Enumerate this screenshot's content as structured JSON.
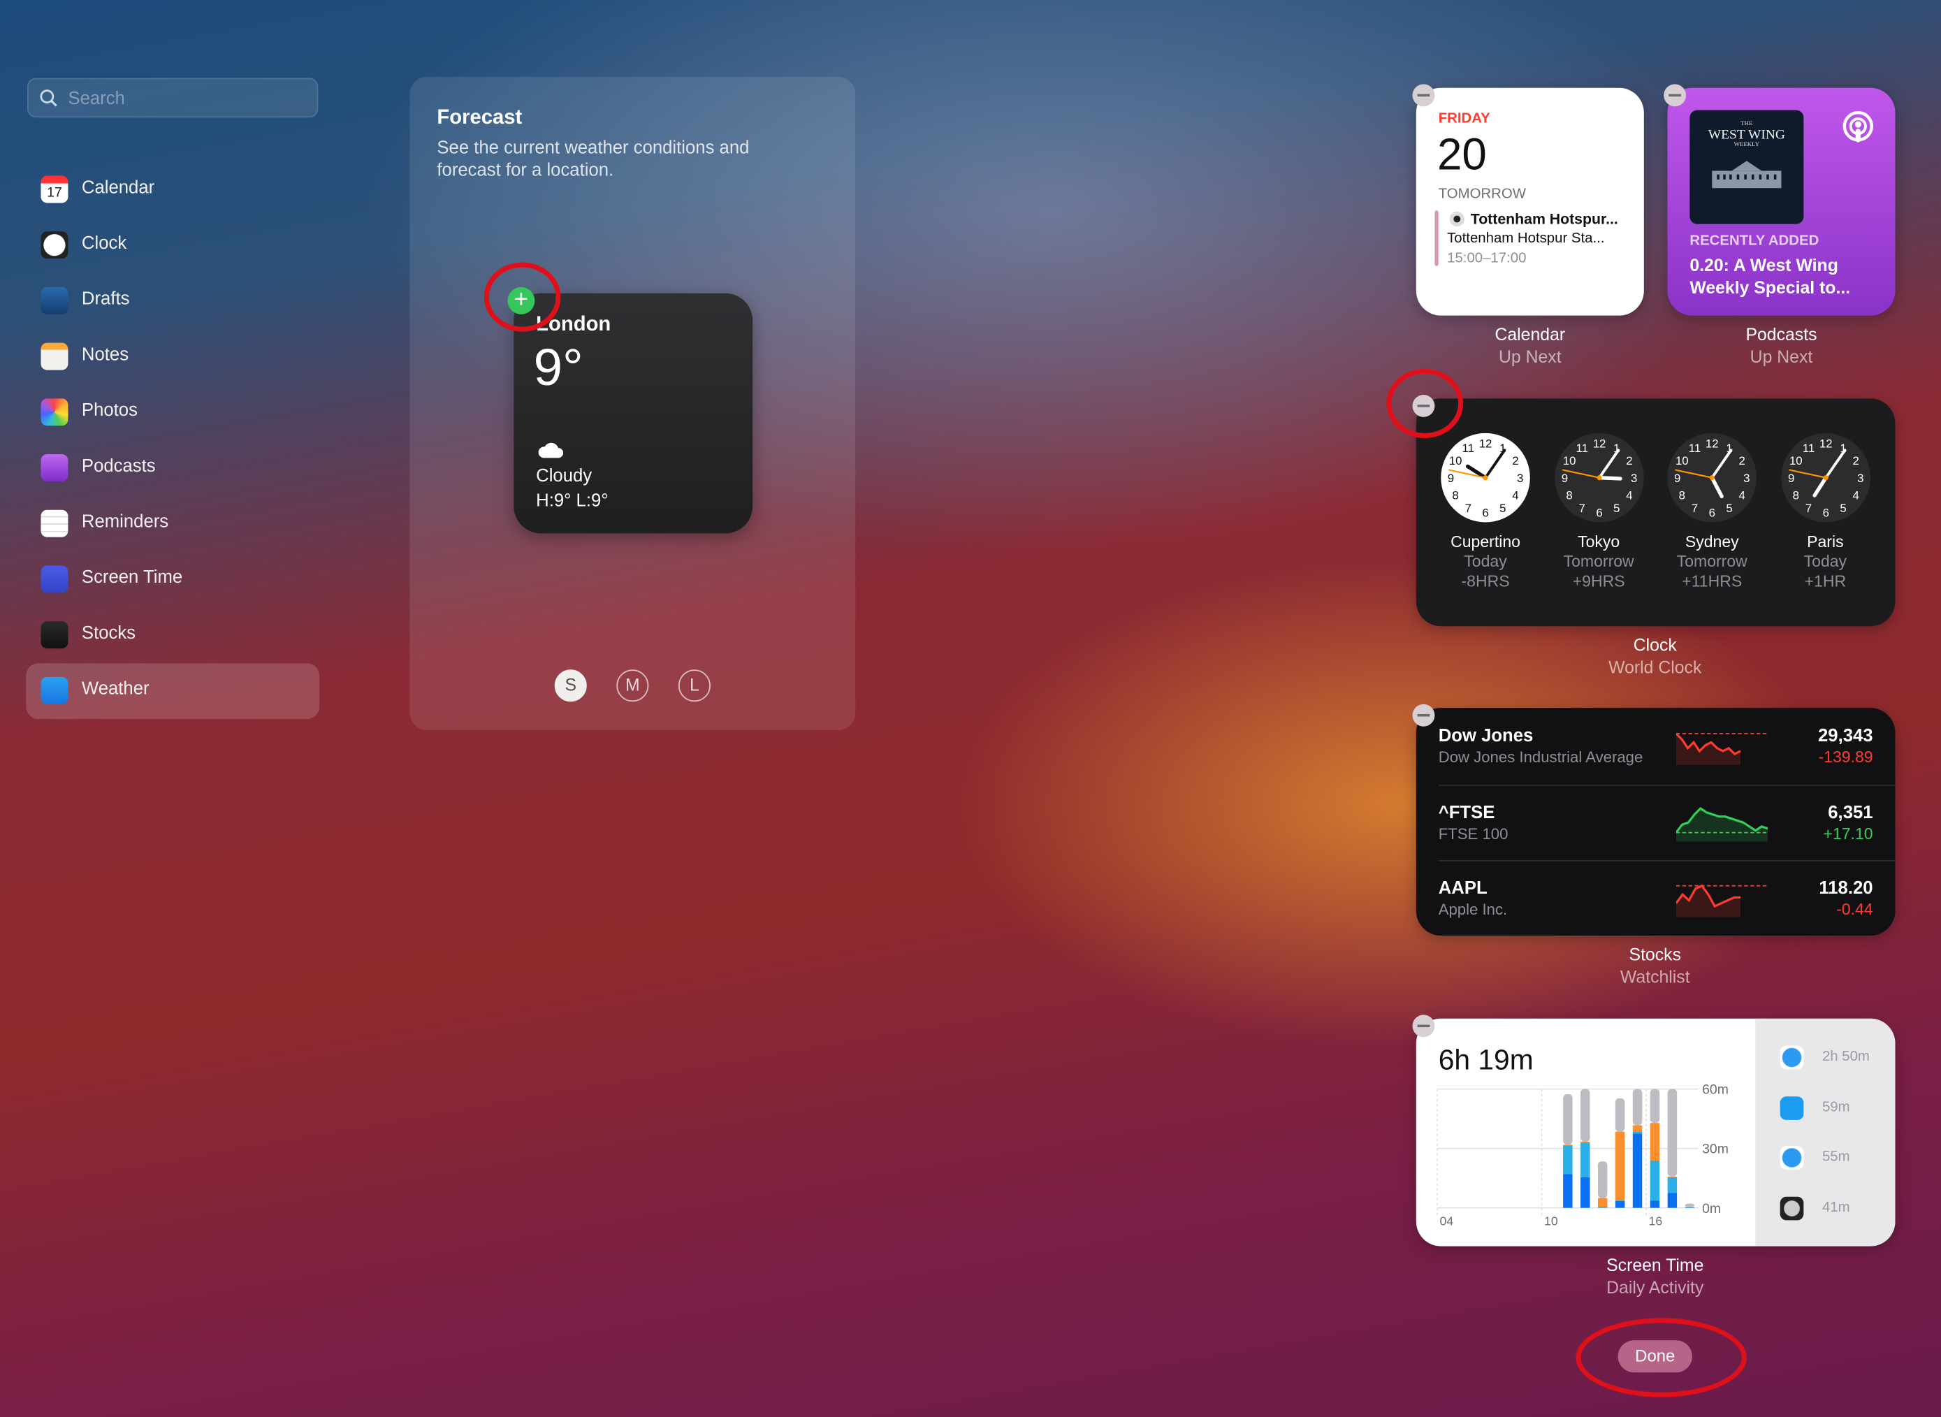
{
  "search": {
    "placeholder": "Search"
  },
  "sidebar": {
    "items": [
      {
        "label": "Calendar",
        "icon": "calendar-icon",
        "badge": "17"
      },
      {
        "label": "Clock",
        "icon": "clock-icon"
      },
      {
        "label": "Drafts",
        "icon": "drafts-icon"
      },
      {
        "label": "Notes",
        "icon": "notes-icon"
      },
      {
        "label": "Photos",
        "icon": "photos-icon"
      },
      {
        "label": "Podcasts",
        "icon": "podcasts-icon"
      },
      {
        "label": "Reminders",
        "icon": "reminders-icon"
      },
      {
        "label": "Screen Time",
        "icon": "screen-time-icon"
      },
      {
        "label": "Stocks",
        "icon": "stocks-icon"
      },
      {
        "label": "Weather",
        "icon": "weather-icon",
        "selected": true
      }
    ]
  },
  "forecast": {
    "title": "Forecast",
    "description": "See the current weather conditions and forecast for a location.",
    "widget": {
      "city": "London",
      "temp": "9°",
      "condition": "Cloudy",
      "hilo": "H:9° L:9°",
      "icon": "cloud-icon"
    },
    "sizes": [
      {
        "label": "S",
        "selected": true
      },
      {
        "label": "M"
      },
      {
        "label": "L"
      }
    ]
  },
  "calendar_widget": {
    "day": "FRIDAY",
    "date": "20",
    "section": "TOMORROW",
    "event_title": "Tottenham Hotspur...",
    "event_location": "Tottenham Hotspur Sta...",
    "event_time": "15:00–17:00",
    "caption": "Calendar",
    "subcaption": "Up Next",
    "accent": "#ff3b30"
  },
  "podcasts_widget": {
    "artwork_text": "WEST WING",
    "artwork_top": "THE",
    "artwork_bottom": "WEEKLY",
    "label": "RECENTLY ADDED",
    "episode": "0.20: A West Wing Weekly Special to...",
    "caption": "Podcasts",
    "subcaption": "Up Next"
  },
  "clock_widget": {
    "caption": "Clock",
    "subcaption": "World Clock",
    "clocks": [
      {
        "city": "Cupertino",
        "day": "Today",
        "offset": "-8HRS",
        "time": "10:05:47",
        "light": true
      },
      {
        "city": "Tokyo",
        "day": "Tomorrow",
        "offset": "+9HRS",
        "time": "03:05:47"
      },
      {
        "city": "Sydney",
        "day": "Tomorrow",
        "offset": "+11HRS",
        "time": "05:05:47"
      },
      {
        "city": "Paris",
        "day": "Today",
        "offset": "+1HR",
        "time": "07:05:47"
      }
    ]
  },
  "stocks_widget": {
    "caption": "Stocks",
    "subcaption": "Watchlist",
    "rows": [
      {
        "symbol": "Dow Jones",
        "name": "Dow Jones Industrial Average",
        "price": "29,343",
        "change": "-139.89",
        "color": "#ff3b30",
        "spark": [
          0,
          -2,
          -5,
          -3,
          -6,
          -4,
          -3,
          -5,
          -6,
          -5,
          -7,
          -6
        ]
      },
      {
        "symbol": "^FTSE",
        "name": "FTSE 100",
        "price": "6,351",
        "change": "+17.10",
        "color": "#30d158",
        "spark": [
          0,
          4,
          5,
          9,
          12,
          10,
          9,
          8,
          8,
          7,
          6,
          5,
          3,
          1,
          3,
          2
        ]
      },
      {
        "symbol": "AAPL",
        "name": "Apple Inc.",
        "price": "118.20",
        "change": "-0.44",
        "color": "#ff3b30",
        "spark": [
          -6,
          -3,
          -5,
          -1,
          0,
          -3,
          -7,
          -6,
          -5,
          -4,
          -4
        ]
      }
    ]
  },
  "screen_time_widget": {
    "total": "6h 19m",
    "caption": "Screen Time",
    "subcaption": "Daily Activity",
    "y_ticks": [
      "60m",
      "30m",
      "0m"
    ],
    "x_ticks": [
      "04",
      "10",
      "16"
    ],
    "chart_data": {
      "type": "bar",
      "stacked": true,
      "ylim": [
        0,
        60
      ],
      "x_range": [
        4,
        19
      ],
      "hours": [
        11,
        12,
        13,
        14,
        15,
        16,
        17,
        18
      ],
      "series": [
        {
          "color": "#0a6ff0",
          "values": [
            17,
            15.5,
            0,
            3.5,
            37.5,
            3.6,
            7.6,
            0.3
          ]
        },
        {
          "color": "#2caee8",
          "values": [
            14.5,
            17.5,
            0.6,
            0.5,
            1,
            20.3,
            7.9,
            0
          ]
        },
        {
          "color": "#fb8f2c",
          "values": [
            0.4,
            0.4,
            4.4,
            34.5,
            3.2,
            19,
            0.3,
            0
          ]
        },
        {
          "color": "#bdbcc2",
          "values": [
            25.5,
            26.6,
            18.5,
            16.8,
            18.3,
            17.1,
            44.2,
            1.9
          ]
        }
      ]
    },
    "apps": [
      {
        "icon": "safari-icon",
        "time": "2h 50m"
      },
      {
        "icon": "twitter-icon",
        "time": "59m"
      },
      {
        "icon": "safari-icon",
        "time": "55m"
      },
      {
        "icon": "disk-utility-icon",
        "time": "41m"
      }
    ]
  },
  "done_button": {
    "label": "Done"
  }
}
